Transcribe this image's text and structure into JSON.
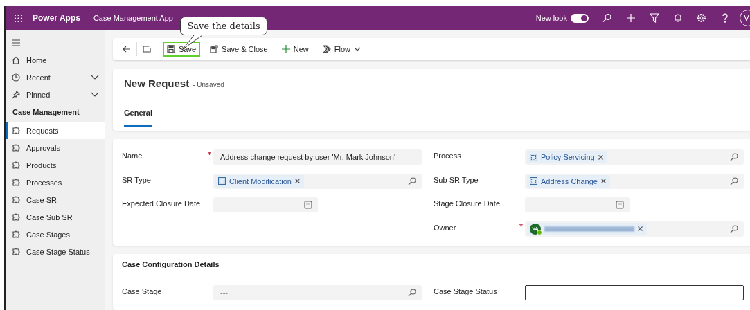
{
  "top_bar": {
    "app_name": "Power Apps",
    "title": "Case Management App",
    "new_look": {
      "label": "New look",
      "on": true
    },
    "avatar": {
      "initials": "V"
    }
  },
  "callout": {
    "text": "Save the details"
  },
  "sidebar": {
    "items": [
      {
        "label": "Home",
        "kind": "home",
        "expandable": false
      },
      {
        "label": "Recent",
        "kind": "recent",
        "expandable": true
      },
      {
        "label": "Pinned",
        "kind": "pinned",
        "expandable": true
      }
    ],
    "section_title": "Case Management",
    "entities": [
      {
        "label": "Requests",
        "selected": true
      },
      {
        "label": "Approvals",
        "selected": false
      },
      {
        "label": "Products",
        "selected": false
      },
      {
        "label": "Processes",
        "selected": false
      },
      {
        "label": "Case SR",
        "selected": false
      },
      {
        "label": "Case Sub SR",
        "selected": false
      },
      {
        "label": "Case Stages",
        "selected": false
      },
      {
        "label": "Case Stage Status",
        "selected": false
      }
    ]
  },
  "toolbar": {
    "buttons": [
      {
        "kind": "save",
        "label": "Save",
        "highlighted": true
      },
      {
        "kind": "save-close",
        "label": "Save & Close",
        "highlighted": false
      },
      {
        "kind": "new",
        "label": "New",
        "highlighted": false
      },
      {
        "kind": "flow",
        "label": "Flow",
        "highlighted": false
      }
    ]
  },
  "header": {
    "title": "New Request",
    "status": "- Unsaved",
    "tabs": [
      {
        "label": "General",
        "selected": true
      }
    ]
  },
  "form": {
    "left_fields": [
      {
        "label": "Name",
        "required": true,
        "kind": "text",
        "value": "Address change request by user 'Mr. Mark Johnson'"
      },
      {
        "label": "SR Type",
        "required": false,
        "kind": "lookup",
        "value": "Client Modification"
      },
      {
        "label": "Expected Closure Date",
        "required": false,
        "kind": "date",
        "placeholder": "---"
      }
    ],
    "right_fields": [
      {
        "label": "Process",
        "required": false,
        "kind": "lookup",
        "value": "Policy Servicing"
      },
      {
        "label": "Sub SR Type",
        "required": false,
        "kind": "lookup",
        "value": "Address Change"
      },
      {
        "label": "Stage Closure Date",
        "required": false,
        "kind": "date",
        "placeholder": "---"
      },
      {
        "label": "Owner",
        "required": true,
        "kind": "person",
        "initials": "VA"
      }
    ]
  },
  "config": {
    "title": "Case Configuration Details",
    "left_fields": [
      {
        "label": "Case Stage",
        "required": false,
        "kind": "empty-lookup",
        "placeholder": "---"
      }
    ],
    "right_fields": [
      {
        "label": "Case Stage Status",
        "required": false,
        "kind": "input"
      }
    ]
  }
}
